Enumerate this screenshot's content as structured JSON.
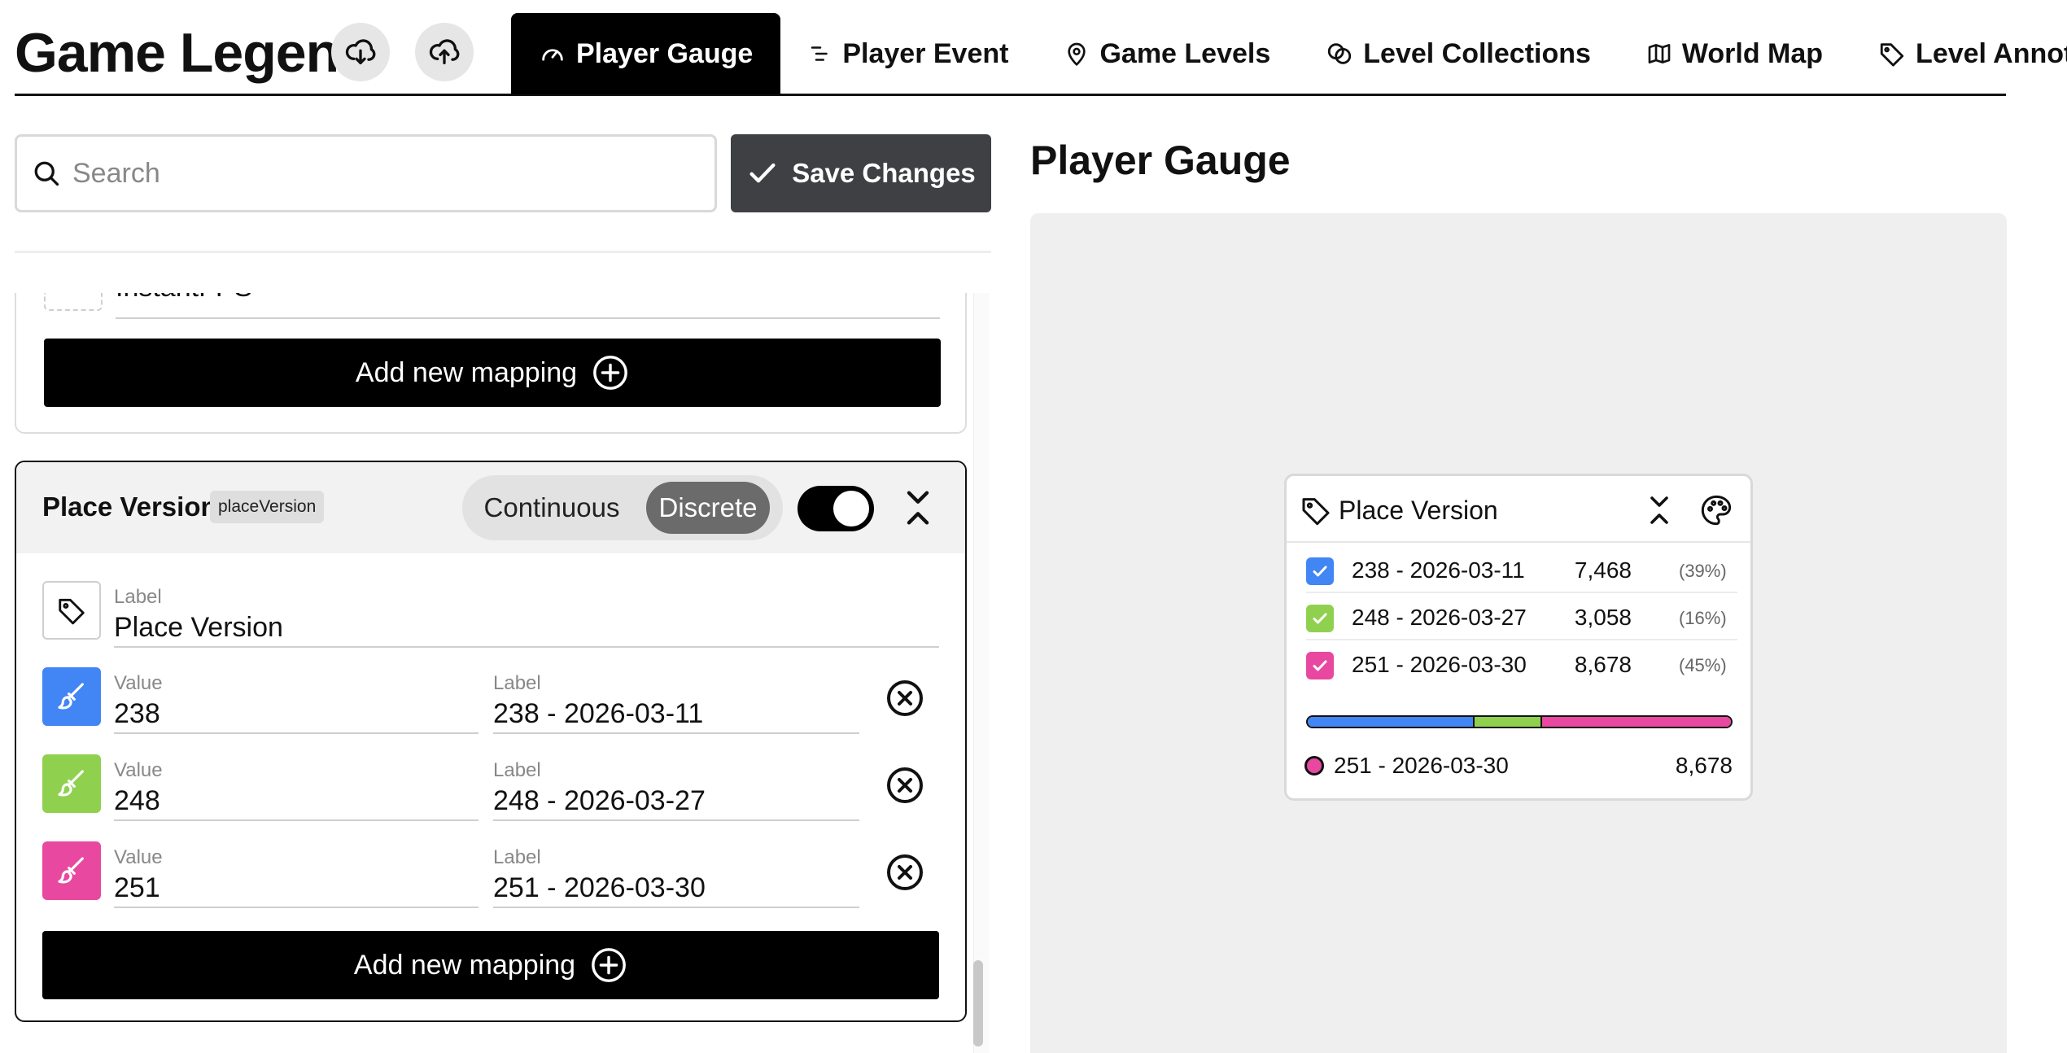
{
  "header": {
    "title": "Game Legend",
    "tabs": [
      {
        "label": "Player Gauge",
        "icon": "gauge-icon",
        "active": true
      },
      {
        "label": "Player Event",
        "icon": "list-icon"
      },
      {
        "label": "Game Levels",
        "icon": "map-pin-icon"
      },
      {
        "label": "Level Collections",
        "icon": "collections-icon"
      },
      {
        "label": "World Map",
        "icon": "map-icon"
      },
      {
        "label": "Level Annotations",
        "icon": "tag-icon"
      }
    ]
  },
  "toolbar": {
    "search_placeholder": "Search",
    "save_label": "Save Changes"
  },
  "previous_card": {
    "partial_value": "InstantFPS",
    "add_label": "Add new mapping"
  },
  "place_version_card": {
    "title": "Place Version",
    "key": "placeVersion",
    "modes": [
      "Continuous",
      "Discrete"
    ],
    "selected_mode": "Discrete",
    "enabled": true,
    "label_caption": "Label",
    "label_value": "Place Version",
    "value_caption": "Value",
    "mappings": [
      {
        "value": "238",
        "label": "238 - 2026-03-11",
        "color": "#4285f4"
      },
      {
        "value": "248",
        "label": "248 - 2026-03-27",
        "color": "#8fd14f"
      },
      {
        "value": "251",
        "label": "251 - 2026-03-30",
        "color": "#e8489f"
      }
    ],
    "add_label": "Add new mapping"
  },
  "preview": {
    "title": "Player Gauge",
    "legend_title": "Place Version",
    "rows": [
      {
        "label": "238 - 2026-03-11",
        "value": "7,468",
        "pct": "(39%)",
        "color": "#4285f4",
        "checked": true
      },
      {
        "label": "248 - 2026-03-27",
        "value": "3,058",
        "pct": "(16%)",
        "color": "#8fd14f",
        "checked": true
      },
      {
        "label": "251 - 2026-03-30",
        "value": "8,678",
        "pct": "(45%)",
        "color": "#e8489f",
        "checked": true
      }
    ],
    "bar_fractions": [
      0.39,
      0.16,
      0.45
    ],
    "hover": {
      "label": "251 - 2026-03-30",
      "value": "8,678",
      "color": "#e8489f"
    }
  }
}
